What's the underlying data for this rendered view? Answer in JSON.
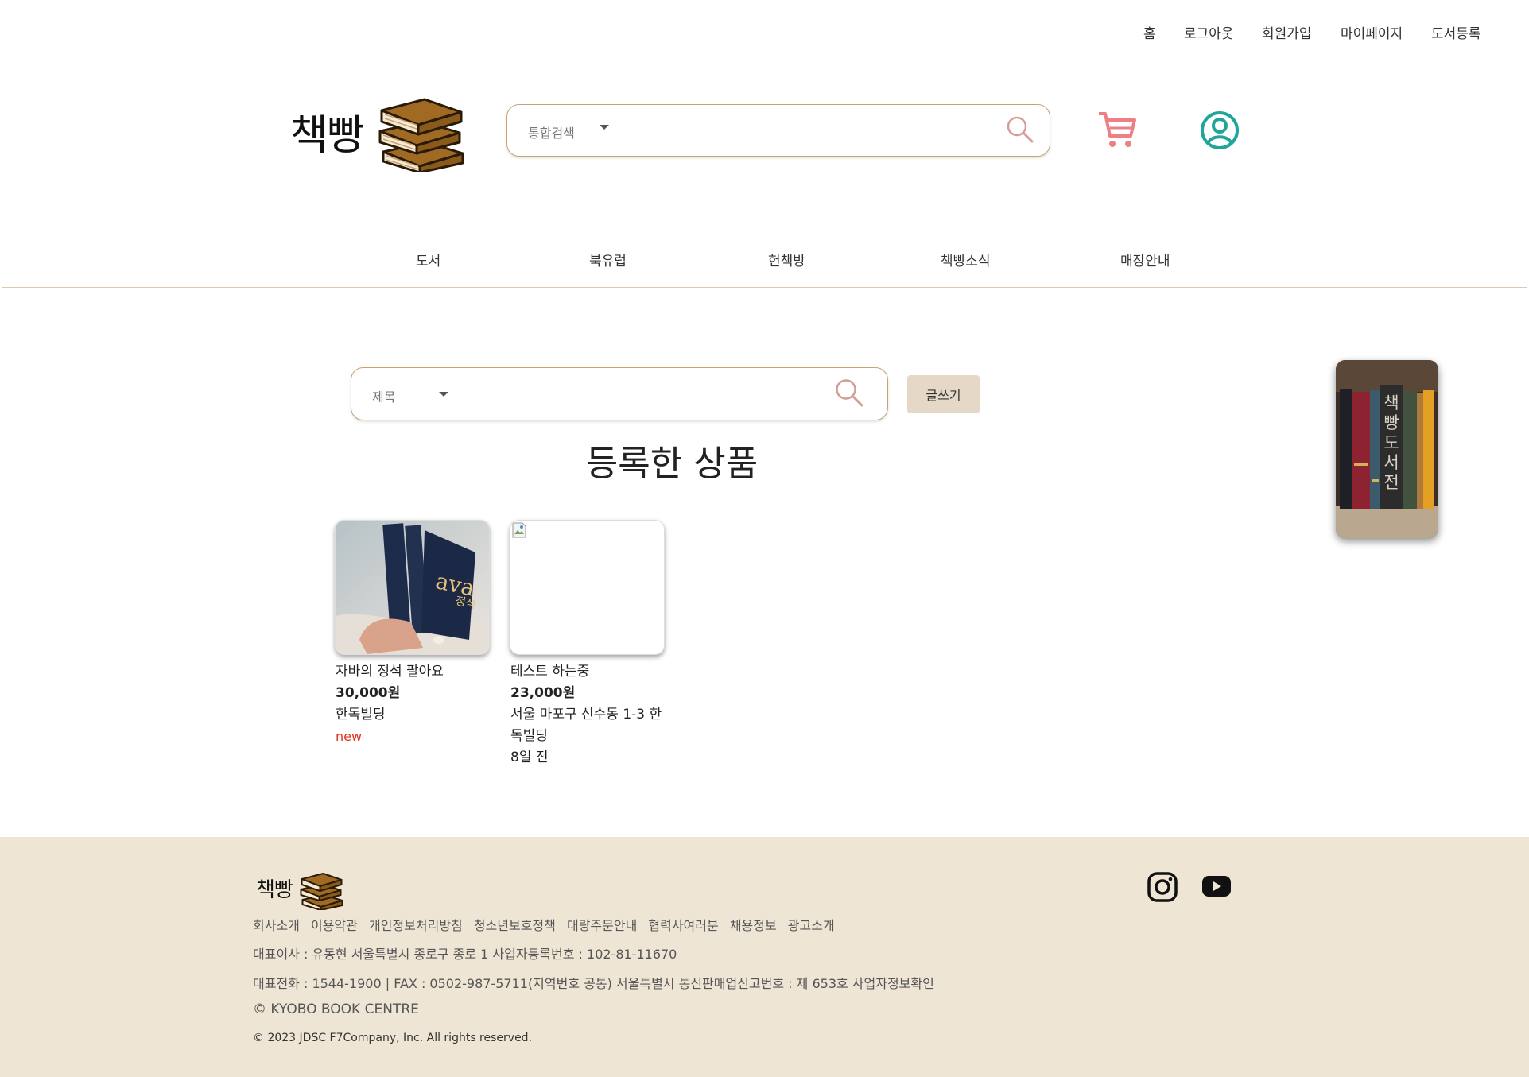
{
  "top_links": [
    "홈",
    "로그아웃",
    "회원가입",
    "마이페이지",
    "도서등록"
  ],
  "header": {
    "logo_text": "책빵",
    "search": {
      "category": "통합검색"
    }
  },
  "nav": [
    "도서",
    "북유럽",
    "헌책방",
    "책빵소식",
    "매장안내"
  ],
  "board": {
    "search_category": "제목",
    "write_button": "글쓰기",
    "title": "등록한 상품"
  },
  "products": [
    {
      "title": "자바의 정석 팔아요",
      "price": "30,000원",
      "location": "한독빌딩",
      "badge": "new",
      "time": ""
    },
    {
      "title": "테스트 하는중",
      "price": "23,000원",
      "location": "서울 마포구 신수동 1-3 한독빌딩",
      "badge": "",
      "time": "8일 전"
    }
  ],
  "side_banner": {
    "title": "책빵도서전"
  },
  "footer": {
    "logo_text": "책빵",
    "links": [
      "회사소개",
      "이용약관",
      "개인정보처리방침",
      "청소년보호정책",
      "대량주문안내",
      "협력사여러분",
      "채용정보",
      "광고소개"
    ],
    "line1": "대표이사 : 유동현 서울특별시 종로구 종로 1 사업자등록번호 : 102-81-11670",
    "line2": "대표전화 : 1544-1900 | FAX : 0502-987-5711(지역번호 공통) 서울특별시 통신판매업신고번호 : 제 653호 사업자정보확인",
    "copyright1": "© KYOBO BOOK CENTRE",
    "copyright2": "© 2023 JDSC F7Company, Inc. All rights reserved."
  },
  "colors": {
    "accent_border": "#c9a273",
    "footer_bg": "#efe5d5",
    "cart": "#ee7f86",
    "user": "#20a59a",
    "new_badge": "#e0321e"
  }
}
